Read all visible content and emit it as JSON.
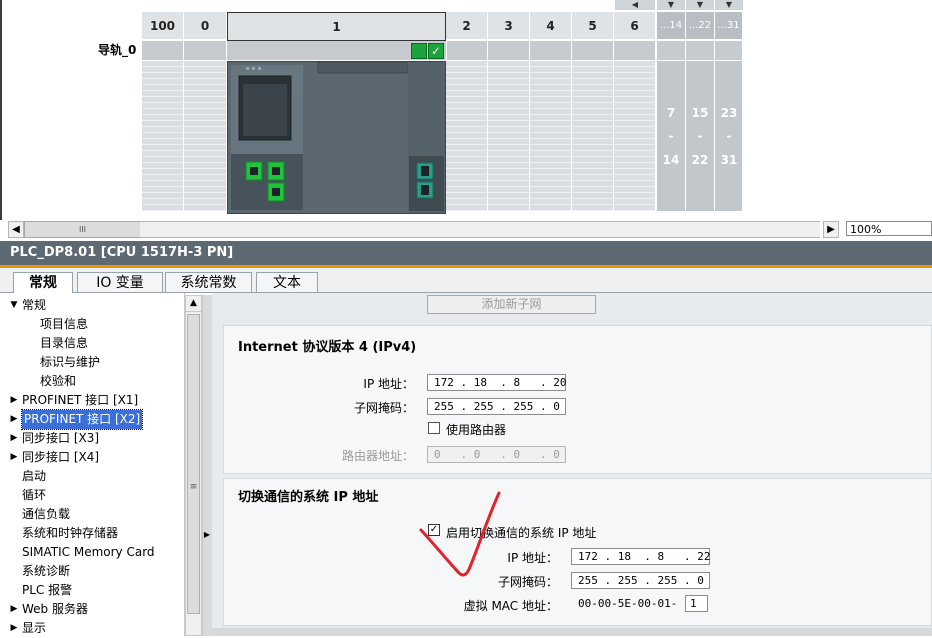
{
  "rack": {
    "rail_label": "导轨_0",
    "slots": [
      "100",
      "0",
      "1",
      "2",
      "3",
      "4",
      "5",
      "6"
    ],
    "extra_slots": [
      {
        "head": "...14",
        "top": "7",
        "sep": "-",
        "bottom": "14"
      },
      {
        "head": "...22",
        "top": "15",
        "sep": "-",
        "bottom": "22"
      },
      {
        "head": "...31",
        "top": "23",
        "sep": "-",
        "bottom": "31"
      }
    ],
    "zoom": "100%",
    "scroll_thumb": "III"
  },
  "inspector": {
    "title": "PLC_DP8.01 [CPU 1517H-3 PN]",
    "tabs": [
      "常规",
      "IO 变量",
      "系统常数",
      "文本"
    ]
  },
  "nav": {
    "items": [
      {
        "label": "常规",
        "arrow": "▼"
      },
      {
        "label": "项目信息",
        "arrow": ""
      },
      {
        "label": "目录信息",
        "arrow": ""
      },
      {
        "label": "标识与维护",
        "arrow": ""
      },
      {
        "label": "校验和",
        "arrow": ""
      },
      {
        "label": "PROFINET 接口 [X1]",
        "arrow": "▶"
      },
      {
        "label": "PROFINET 接口 [X2]",
        "arrow": "▶"
      },
      {
        "label": "同步接口 [X3]",
        "arrow": "▶"
      },
      {
        "label": "同步接口 [X4]",
        "arrow": "▶"
      },
      {
        "label": "启动",
        "arrow": ""
      },
      {
        "label": "循环",
        "arrow": ""
      },
      {
        "label": "通信负载",
        "arrow": ""
      },
      {
        "label": "系统和时钟存储器",
        "arrow": ""
      },
      {
        "label": "SIMATIC Memory Card",
        "arrow": ""
      },
      {
        "label": "系统诊断",
        "arrow": ""
      },
      {
        "label": "PLC 报警",
        "arrow": ""
      },
      {
        "label": "Web 服务器",
        "arrow": "▶"
      },
      {
        "label": "显示",
        "arrow": "▶"
      }
    ]
  },
  "content": {
    "add_subnet_button": "添加新子网",
    "ipv4": {
      "title": "Internet 协议版本 4 (IPv4)",
      "ip_label": "IP 地址：",
      "ip_value": "172 . 18  . 8   . 20",
      "mask_label": "子网掩码：",
      "mask_value": "255 . 255 . 255 . 0",
      "use_router_label": "使用路由器",
      "use_router_checked": false,
      "router_label": "路由器地址：",
      "router_value": "0   . 0   . 0   . 0"
    },
    "switch": {
      "title": "切换通信的系统 IP 地址",
      "enable_label": "启用切换通信的系统 IP 地址",
      "enable_checked": true,
      "ip_label": "IP 地址：",
      "ip_value": "172 . 18  . 8   . 22",
      "mask_label": "子网掩码：",
      "mask_value": "255 . 255 . 255 . 0",
      "mac_label": "虚拟 MAC 地址：",
      "mac_prefix": "00-00-5E-00-01-",
      "mac_value": "1"
    }
  },
  "colors": {
    "title_bar": "#5d6973",
    "accent_orange": "#f29400",
    "selected_nav": "#3a6fd8",
    "annotation_red": "#e0242a"
  }
}
